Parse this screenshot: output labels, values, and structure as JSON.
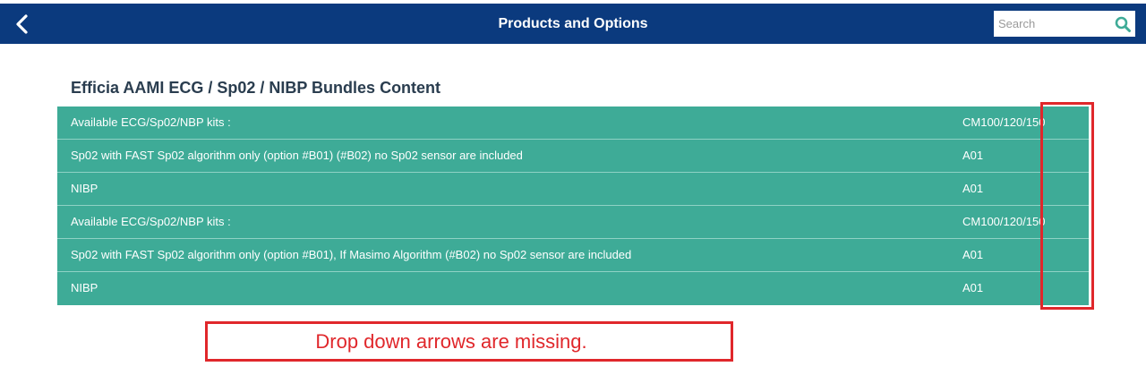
{
  "header": {
    "title": "Products and Options",
    "back_icon": "chevron-left-icon",
    "search": {
      "placeholder": "Search",
      "value": "",
      "icon": "search-icon"
    }
  },
  "section": {
    "title": "Efficia AAMI ECG / Sp02 / NIBP Bundles Content"
  },
  "rows": [
    {
      "name": "Available ECG/Sp02/NBP kits :",
      "code": "CM100/120/150"
    },
    {
      "name": "Sp02 with FAST Sp02 algorithm only (option #B01) (#B02) no Sp02 sensor are included",
      "code": "A01"
    },
    {
      "name": "NIBP",
      "code": "A01"
    },
    {
      "name": "Available ECG/Sp02/NBP kits :",
      "code": "CM100/120/150"
    },
    {
      "name": "Sp02 with FAST Sp02 algorithm only (option #B01), If Masimo Algorithm (#B02) no Sp02 sensor are included",
      "code": "A01"
    },
    {
      "name": "NIBP",
      "code": "A01"
    }
  ],
  "annotation": {
    "note": "Drop down arrows are missing."
  },
  "colors": {
    "header_bg": "#0b3a7e",
    "row_bg": "#3eab97",
    "annotation_red": "#e0272b",
    "section_title": "#2a3d4f"
  }
}
